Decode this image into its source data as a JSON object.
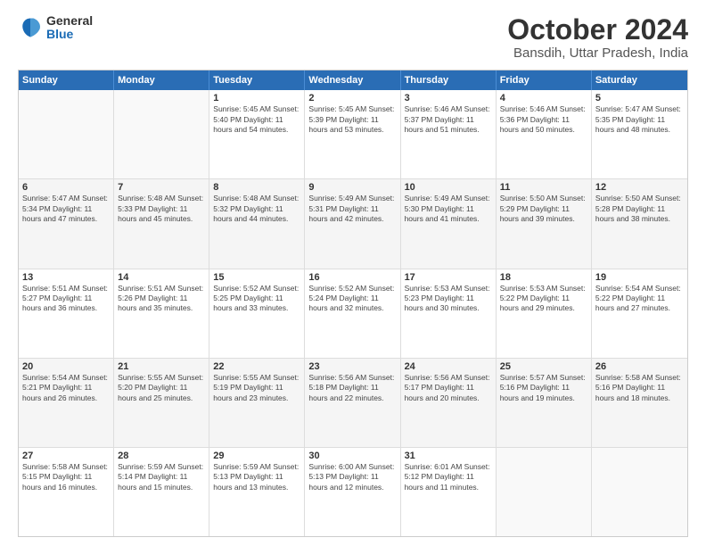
{
  "logo": {
    "general": "General",
    "blue": "Blue"
  },
  "title": "October 2024",
  "subtitle": "Bansdih, Uttar Pradesh, India",
  "days": [
    "Sunday",
    "Monday",
    "Tuesday",
    "Wednesday",
    "Thursday",
    "Friday",
    "Saturday"
  ],
  "weeks": [
    [
      {
        "date": "",
        "detail": ""
      },
      {
        "date": "",
        "detail": ""
      },
      {
        "date": "1",
        "detail": "Sunrise: 5:45 AM\nSunset: 5:40 PM\nDaylight: 11 hours and 54 minutes."
      },
      {
        "date": "2",
        "detail": "Sunrise: 5:45 AM\nSunset: 5:39 PM\nDaylight: 11 hours and 53 minutes."
      },
      {
        "date": "3",
        "detail": "Sunrise: 5:46 AM\nSunset: 5:37 PM\nDaylight: 11 hours and 51 minutes."
      },
      {
        "date": "4",
        "detail": "Sunrise: 5:46 AM\nSunset: 5:36 PM\nDaylight: 11 hours and 50 minutes."
      },
      {
        "date": "5",
        "detail": "Sunrise: 5:47 AM\nSunset: 5:35 PM\nDaylight: 11 hours and 48 minutes."
      }
    ],
    [
      {
        "date": "6",
        "detail": "Sunrise: 5:47 AM\nSunset: 5:34 PM\nDaylight: 11 hours and 47 minutes."
      },
      {
        "date": "7",
        "detail": "Sunrise: 5:48 AM\nSunset: 5:33 PM\nDaylight: 11 hours and 45 minutes."
      },
      {
        "date": "8",
        "detail": "Sunrise: 5:48 AM\nSunset: 5:32 PM\nDaylight: 11 hours and 44 minutes."
      },
      {
        "date": "9",
        "detail": "Sunrise: 5:49 AM\nSunset: 5:31 PM\nDaylight: 11 hours and 42 minutes."
      },
      {
        "date": "10",
        "detail": "Sunrise: 5:49 AM\nSunset: 5:30 PM\nDaylight: 11 hours and 41 minutes."
      },
      {
        "date": "11",
        "detail": "Sunrise: 5:50 AM\nSunset: 5:29 PM\nDaylight: 11 hours and 39 minutes."
      },
      {
        "date": "12",
        "detail": "Sunrise: 5:50 AM\nSunset: 5:28 PM\nDaylight: 11 hours and 38 minutes."
      }
    ],
    [
      {
        "date": "13",
        "detail": "Sunrise: 5:51 AM\nSunset: 5:27 PM\nDaylight: 11 hours and 36 minutes."
      },
      {
        "date": "14",
        "detail": "Sunrise: 5:51 AM\nSunset: 5:26 PM\nDaylight: 11 hours and 35 minutes."
      },
      {
        "date": "15",
        "detail": "Sunrise: 5:52 AM\nSunset: 5:25 PM\nDaylight: 11 hours and 33 minutes."
      },
      {
        "date": "16",
        "detail": "Sunrise: 5:52 AM\nSunset: 5:24 PM\nDaylight: 11 hours and 32 minutes."
      },
      {
        "date": "17",
        "detail": "Sunrise: 5:53 AM\nSunset: 5:23 PM\nDaylight: 11 hours and 30 minutes."
      },
      {
        "date": "18",
        "detail": "Sunrise: 5:53 AM\nSunset: 5:22 PM\nDaylight: 11 hours and 29 minutes."
      },
      {
        "date": "19",
        "detail": "Sunrise: 5:54 AM\nSunset: 5:22 PM\nDaylight: 11 hours and 27 minutes."
      }
    ],
    [
      {
        "date": "20",
        "detail": "Sunrise: 5:54 AM\nSunset: 5:21 PM\nDaylight: 11 hours and 26 minutes."
      },
      {
        "date": "21",
        "detail": "Sunrise: 5:55 AM\nSunset: 5:20 PM\nDaylight: 11 hours and 25 minutes."
      },
      {
        "date": "22",
        "detail": "Sunrise: 5:55 AM\nSunset: 5:19 PM\nDaylight: 11 hours and 23 minutes."
      },
      {
        "date": "23",
        "detail": "Sunrise: 5:56 AM\nSunset: 5:18 PM\nDaylight: 11 hours and 22 minutes."
      },
      {
        "date": "24",
        "detail": "Sunrise: 5:56 AM\nSunset: 5:17 PM\nDaylight: 11 hours and 20 minutes."
      },
      {
        "date": "25",
        "detail": "Sunrise: 5:57 AM\nSunset: 5:16 PM\nDaylight: 11 hours and 19 minutes."
      },
      {
        "date": "26",
        "detail": "Sunrise: 5:58 AM\nSunset: 5:16 PM\nDaylight: 11 hours and 18 minutes."
      }
    ],
    [
      {
        "date": "27",
        "detail": "Sunrise: 5:58 AM\nSunset: 5:15 PM\nDaylight: 11 hours and 16 minutes."
      },
      {
        "date": "28",
        "detail": "Sunrise: 5:59 AM\nSunset: 5:14 PM\nDaylight: 11 hours and 15 minutes."
      },
      {
        "date": "29",
        "detail": "Sunrise: 5:59 AM\nSunset: 5:13 PM\nDaylight: 11 hours and 13 minutes."
      },
      {
        "date": "30",
        "detail": "Sunrise: 6:00 AM\nSunset: 5:13 PM\nDaylight: 11 hours and 12 minutes."
      },
      {
        "date": "31",
        "detail": "Sunrise: 6:01 AM\nSunset: 5:12 PM\nDaylight: 11 hours and 11 minutes."
      },
      {
        "date": "",
        "detail": ""
      },
      {
        "date": "",
        "detail": ""
      }
    ]
  ]
}
